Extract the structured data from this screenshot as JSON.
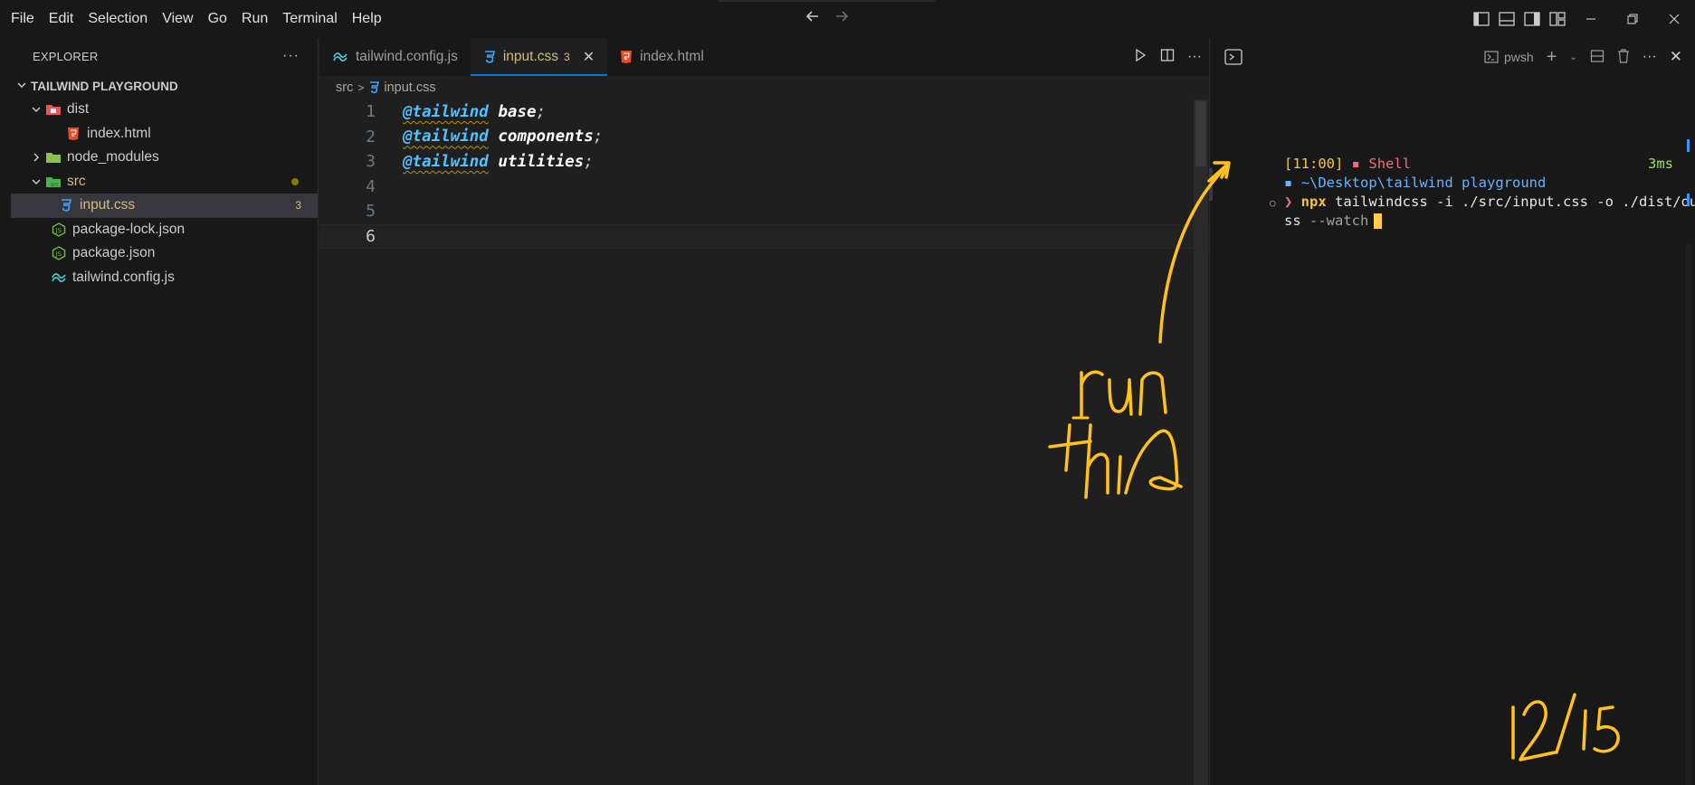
{
  "menu": {
    "items": [
      "File",
      "Edit",
      "Selection",
      "View",
      "Go",
      "Run",
      "Terminal",
      "Help"
    ]
  },
  "sidebar": {
    "title": "EXPLORER",
    "project": "TAILWIND PLAYGROUND",
    "items": [
      {
        "label": "dist",
        "icon": "folder-red-icon"
      },
      {
        "label": "index.html",
        "icon": "html-icon"
      },
      {
        "label": "node_modules",
        "icon": "folder-green-icon"
      },
      {
        "label": "src",
        "icon": "folder-src-icon"
      },
      {
        "label": "input.css",
        "icon": "css-icon",
        "badge": "3"
      },
      {
        "label": "package-lock.json",
        "icon": "node-json-icon"
      },
      {
        "label": "package.json",
        "icon": "node-json-icon"
      },
      {
        "label": "tailwind.config.js",
        "icon": "tailwind-icon"
      }
    ]
  },
  "tabs": [
    {
      "label": "tailwind.config.js",
      "icon": "tailwind-icon"
    },
    {
      "label": "input.css",
      "icon": "css-icon",
      "badge": "3",
      "active": true
    },
    {
      "label": "index.html",
      "icon": "html-icon"
    }
  ],
  "breadcrumb": {
    "folder": "src",
    "file": "input.css"
  },
  "editor": {
    "lines": [
      {
        "num": "1",
        "directive": "@tailwind",
        "arg": "base",
        "semi": ";"
      },
      {
        "num": "2",
        "directive": "@tailwind",
        "arg": "components",
        "semi": ";"
      },
      {
        "num": "3",
        "directive": "@tailwind",
        "arg": "utilities",
        "semi": ";"
      },
      {
        "num": "4"
      },
      {
        "num": "5"
      },
      {
        "num": "6"
      }
    ]
  },
  "terminal": {
    "profile": "pwsh",
    "time": "[11:00]",
    "shell": "Shell",
    "duration": "3ms",
    "path": "~\\Desktop\\tailwind playground",
    "cmd": "npx",
    "args_line1": "tailwindcss -i ./src/input.css -o ./dist/output.c",
    "args_line2_a": "ss",
    "args_line2_b": "--watch"
  },
  "annotation": {
    "note": "run this",
    "date": "12/15",
    "color": "#ffc21a"
  }
}
